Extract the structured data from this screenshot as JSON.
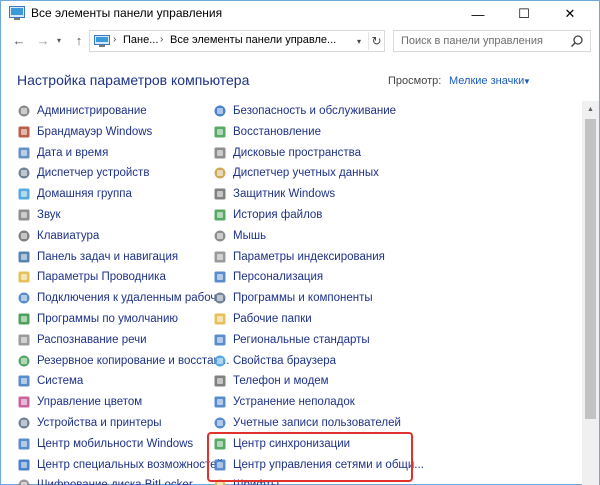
{
  "window": {
    "title": "Все элементы панели управления",
    "min_glyph": "—",
    "max_glyph": "☐",
    "close_glyph": "✕"
  },
  "nav": {
    "back_glyph": "←",
    "forward_glyph": "→",
    "history_glyph": "▾",
    "up_glyph": "↑"
  },
  "address": {
    "segment1": "Пане...",
    "segment2": "Все элементы панели управле...",
    "separator": "›",
    "dropdown_glyph": "▾",
    "refresh_glyph": "↻"
  },
  "search": {
    "placeholder": "Поиск в панели управления"
  },
  "header": {
    "title": "Настройка параметров компьютера",
    "view_label": "Просмотр:",
    "view_value": "Мелкие значки",
    "view_arrow": "▼"
  },
  "items_left": [
    {
      "label": "Администрирование",
      "icon": "admin-tools-icon",
      "color": "#7a7a7a"
    },
    {
      "label": "Брандмауэр Windows",
      "icon": "firewall-icon",
      "color": "#b0432a"
    },
    {
      "label": "Дата и время",
      "icon": "clock-icon",
      "color": "#4a7ebb"
    },
    {
      "label": "Диспетчер устройств",
      "icon": "device-manager-icon",
      "color": "#5a6f86"
    },
    {
      "label": "Домашняя группа",
      "icon": "homegroup-icon",
      "color": "#3a9ad9"
    },
    {
      "label": "Звук",
      "icon": "speaker-icon",
      "color": "#7a7a7a"
    },
    {
      "label": "Клавиатура",
      "icon": "keyboard-icon",
      "color": "#6b6b6b"
    },
    {
      "label": "Панель задач и навигация",
      "icon": "taskbar-icon",
      "color": "#3b6ea5"
    },
    {
      "label": "Параметры Проводника",
      "icon": "folder-options-icon",
      "color": "#e2b540"
    },
    {
      "label": "Подключения к удаленным рабоч...",
      "icon": "remote-desktop-icon",
      "color": "#3b78c4"
    },
    {
      "label": "Программы по умолчанию",
      "icon": "default-programs-icon",
      "color": "#2f8f3f"
    },
    {
      "label": "Распознавание речи",
      "icon": "microphone-icon",
      "color": "#8a8a8a"
    },
    {
      "label": "Резервное копирование и восстан...",
      "icon": "backup-icon",
      "color": "#3a9a4a"
    },
    {
      "label": "Система",
      "icon": "system-icon",
      "color": "#3b78c4"
    },
    {
      "label": "Управление цветом",
      "icon": "color-management-icon",
      "color": "#c04a8a"
    },
    {
      "label": "Устройства и принтеры",
      "icon": "printer-icon",
      "color": "#5a6f86"
    },
    {
      "label": "Центр мобильности Windows",
      "icon": "mobility-center-icon",
      "color": "#3b78c4"
    },
    {
      "label": "Центр специальных возможностей",
      "icon": "accessibility-icon",
      "color": "#2b6cc4"
    },
    {
      "label": "Шифрование диска BitLocker",
      "icon": "bitlocker-icon",
      "color": "#8a8a8a"
    }
  ],
  "items_right": [
    {
      "label": "Безопасность и обслуживание",
      "icon": "security-flag-icon",
      "color": "#2b6cc4"
    },
    {
      "label": "Восстановление",
      "icon": "recovery-icon",
      "color": "#3a9a4a"
    },
    {
      "label": "Дисковые пространства",
      "icon": "storage-spaces-icon",
      "color": "#7a7a7a"
    },
    {
      "label": "Диспетчер учетных данных",
      "icon": "credential-manager-icon",
      "color": "#c49a3a"
    },
    {
      "label": "Защитник Windows",
      "icon": "defender-icon",
      "color": "#6b6b6b"
    },
    {
      "label": "История файлов",
      "icon": "file-history-icon",
      "color": "#3a9a4a"
    },
    {
      "label": "Мышь",
      "icon": "mouse-icon",
      "color": "#7a7a7a"
    },
    {
      "label": "Параметры индексирования",
      "icon": "indexing-icon",
      "color": "#8a8a8a"
    },
    {
      "label": "Персонализация",
      "icon": "personalization-icon",
      "color": "#3b78c4"
    },
    {
      "label": "Программы и компоненты",
      "icon": "programs-icon",
      "color": "#5a6f86"
    },
    {
      "label": "Рабочие папки",
      "icon": "work-folders-icon",
      "color": "#e2b540"
    },
    {
      "label": "Региональные стандарты",
      "icon": "region-icon",
      "color": "#3b78c4"
    },
    {
      "label": "Свойства браузера",
      "icon": "internet-options-icon",
      "color": "#3a9ad9"
    },
    {
      "label": "Телефон и модем",
      "icon": "phone-modem-icon",
      "color": "#6b6b6b"
    },
    {
      "label": "Устранение неполадок",
      "icon": "troubleshooting-icon",
      "color": "#3b78c4"
    },
    {
      "label": "Учетные записи пользователей",
      "icon": "user-accounts-icon",
      "color": "#3b78c4"
    },
    {
      "label": "Центр синхронизации",
      "icon": "sync-center-icon",
      "color": "#3a9a4a"
    },
    {
      "label": "Центр управления сетями и общи...",
      "icon": "network-center-icon",
      "color": "#3b78c4"
    },
    {
      "label": "Шрифты",
      "icon": "fonts-icon",
      "color": "#e2b540"
    }
  ],
  "scroll": {
    "up_glyph": "▲"
  },
  "colors": {
    "link": "#1e3287",
    "accent": "#1c5dbb",
    "highlight_border": "#e0322c"
  }
}
